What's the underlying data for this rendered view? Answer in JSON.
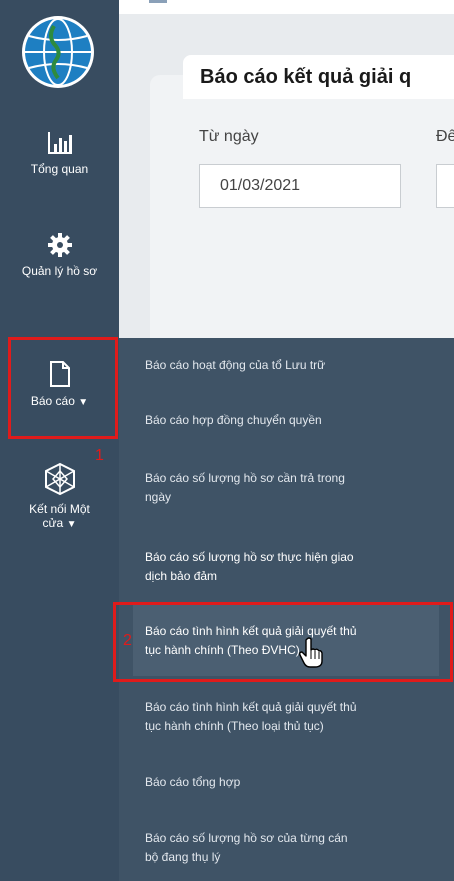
{
  "header": {
    "report_title": "Báo cáo kết quả giải q",
    "from_label": "Từ ngày",
    "from_value": "01/03/2021",
    "to_label": "Đế"
  },
  "sidebar": {
    "items": [
      {
        "label": "Tổng quan",
        "icon": "bar-chart-icon"
      },
      {
        "label": "Quản lý hồ sơ",
        "icon": "gear-icon"
      },
      {
        "label": "Báo cáo",
        "icon": "document-icon"
      },
      {
        "label": "Kết nối Một",
        "label2": "cửa",
        "icon": "network-icon"
      }
    ]
  },
  "submenu": {
    "items": [
      "Báo cáo hoạt động của tổ Lưu trữ",
      "Báo cáo hợp đồng chuyển quyền",
      "Báo cáo số lượng hồ sơ cần trả trong",
      "ngày",
      "Báo cáo số lượng hồ sơ thực hiện giao",
      "dịch bảo đảm",
      "Báo cáo tình hình kết quả giải quyết thủ",
      "tục hành chính (Theo ĐVHC)",
      "Báo cáo tình hình kết quả giải quyết thủ",
      "tục hành chính (Theo loại thủ tục)",
      "Báo cáo tổng hợp",
      "Báo cáo số lượng hồ sơ của từng cán",
      "bộ đang thụ lý"
    ]
  },
  "annotations": {
    "step1": "1",
    "step2": "2"
  },
  "colors": {
    "sidebar": "#384c60",
    "submenu": "#3f5366",
    "highlight": "#e01b1b"
  }
}
